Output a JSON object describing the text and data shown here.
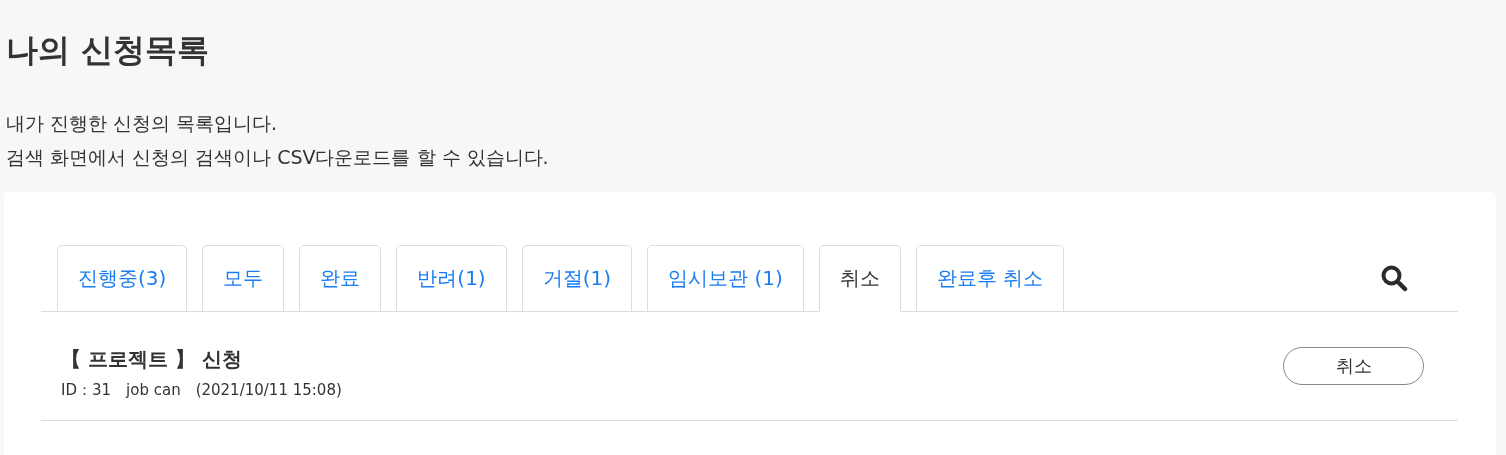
{
  "page": {
    "title": "나의 신청목록",
    "description": [
      "내가 진행한 신청의 목록입니다.",
      "검색 화면에서 신청의 검색이나 CSV다운로드를 할 수 있습니다."
    ]
  },
  "tabs": [
    {
      "label": "진행중(3)",
      "selected": false
    },
    {
      "label": "모두",
      "selected": false
    },
    {
      "label": "완료",
      "selected": false
    },
    {
      "label": "반려(1)",
      "selected": false
    },
    {
      "label": "거절(1)",
      "selected": false
    },
    {
      "label": "임시보관 (1)",
      "selected": false
    },
    {
      "label": "취소",
      "selected": true
    },
    {
      "label": "완료후 취소",
      "selected": false
    }
  ],
  "requests": [
    {
      "title": "【 프로젝트 】 신청",
      "meta": "ID：31　job can　(2021/10/11 15:08)",
      "action": "취소"
    }
  ]
}
